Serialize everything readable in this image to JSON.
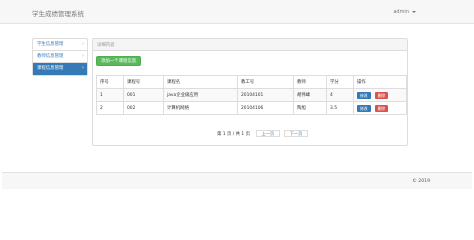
{
  "header": {
    "brand": "学生成绩管理系统",
    "user": "admin"
  },
  "sidebar": {
    "items": [
      {
        "label": "学生信息管理"
      },
      {
        "label": "教师信息管理"
      },
      {
        "label": "课程信息管理"
      }
    ],
    "active_index": 2
  },
  "panel": {
    "heading": "详细内容"
  },
  "toolbar": {
    "add_label": "添加一个课程信息"
  },
  "table": {
    "columns": [
      "序号",
      "课程号",
      "课程名",
      "教工号",
      "教师",
      "学分",
      "操作"
    ],
    "rows": [
      {
        "index": "1",
        "course_no": "001",
        "course_name": "java企业级应用",
        "teacher_no": "20104101",
        "teacher": "胡伟峰",
        "credit": "4",
        "edit_label": "修改",
        "delete_label": "删除"
      },
      {
        "index": "2",
        "course_no": "002",
        "course_name": "计算机网络",
        "teacher_no": "20104106",
        "teacher": "陶旭",
        "credit": "3.5",
        "edit_label": "修改",
        "delete_label": "删除"
      }
    ]
  },
  "pager": {
    "info": "第 1 页 / 共 1 页",
    "prev_label": "上一页",
    "next_label": "下一页"
  },
  "footer": {
    "copyright": "© 2019"
  },
  "colors": {
    "primary": "#337ab7",
    "success": "#5cb85c",
    "danger": "#d9534f",
    "navbar_bg": "#f7f7f7"
  }
}
